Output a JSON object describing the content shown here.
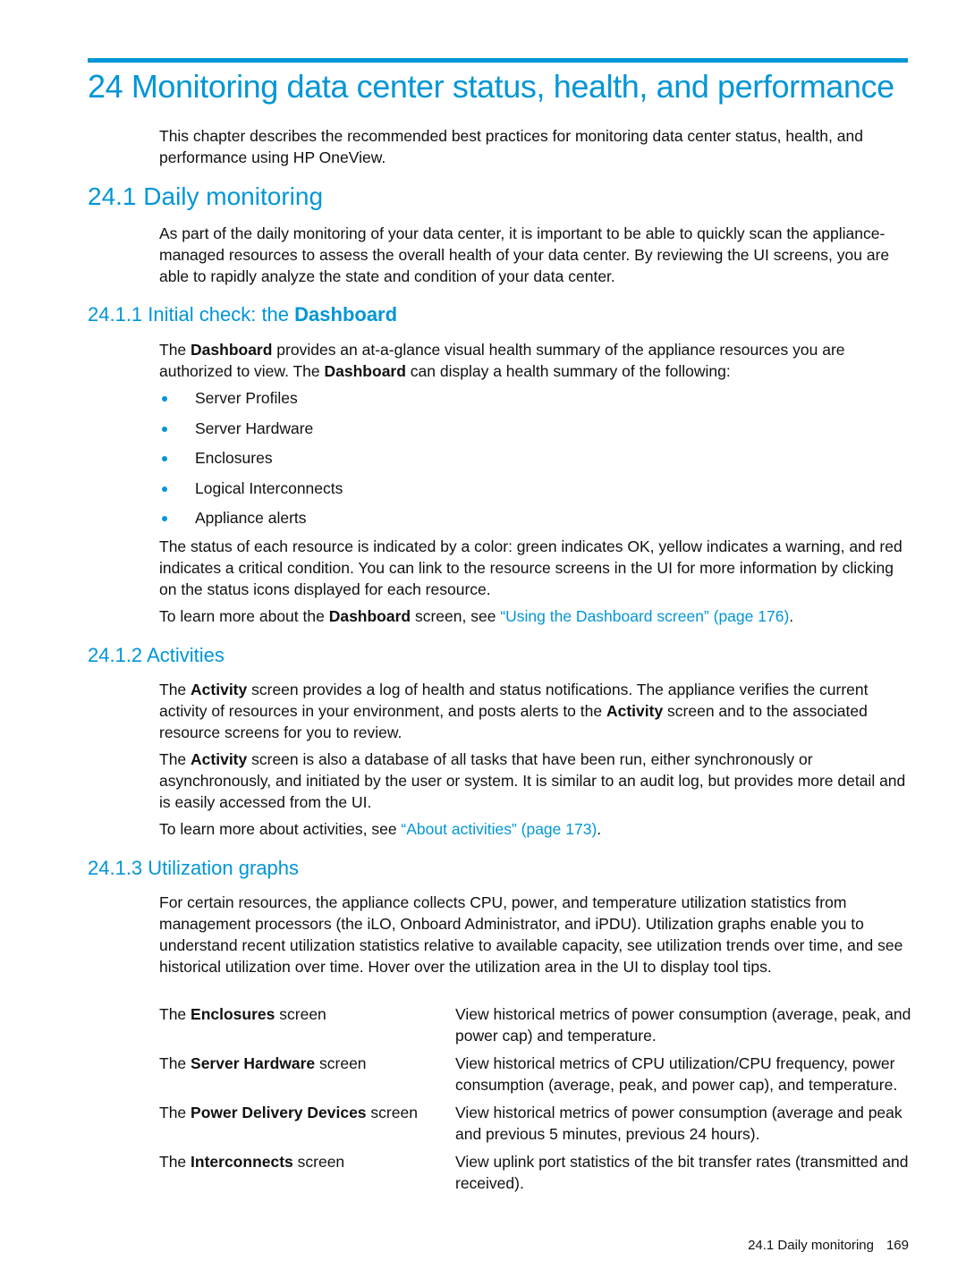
{
  "chapter": {
    "title": "24 Monitoring data center status, health, and performance",
    "intro": "This chapter describes the recommended best practices for monitoring data center status, health, and performance using HP OneView."
  },
  "section_24_1": {
    "heading": "24.1 Daily monitoring",
    "body": "As part of the daily monitoring of your data center, it is important to be able to quickly scan the appliance-managed resources to assess the overall health of your data center. By reviewing the UI screens, you are able to rapidly analyze the state and condition of your data center."
  },
  "section_24_1_1": {
    "heading_prefix": "24.1.1 Initial check: the ",
    "heading_bold": "Dashboard",
    "p1": {
      "t1": "The ",
      "b1": "Dashboard",
      "t2": " provides an at-a-glance visual health summary of the appliance resources you are authorized to view. The ",
      "b2": "Dashboard",
      "t3": " can display a health summary of the following:"
    },
    "bullets": [
      "Server Profiles",
      "Server Hardware",
      "Enclosures",
      "Logical Interconnects",
      "Appliance alerts"
    ],
    "p2": "The status of each resource is indicated by a color: green indicates OK, yellow indicates a warning, and red indicates a critical condition. You can link to the resource screens in the UI for more information by clicking on the status icons displayed for each resource.",
    "p3": {
      "t1": "To learn more about the ",
      "b1": "Dashboard",
      "t2": " screen, see ",
      "link": "“Using the Dashboard screen” (page 176)",
      "t3": "."
    }
  },
  "section_24_1_2": {
    "heading": "24.1.2 Activities",
    "p1": {
      "t1": "The ",
      "b1": "Activity",
      "t2": " screen provides a log of health and status notifications. The appliance verifies the current activity of resources in your environment, and posts alerts to the ",
      "b2": "Activity",
      "t3": " screen and to the associated resource screens for you to review."
    },
    "p2": {
      "t1": "The ",
      "b1": "Activity",
      "t2": " screen is also a database of all tasks that have been run, either synchronously or asynchronously, and initiated by the user or system. It is similar to an audit log, but provides more detail and is easily accessed from the UI."
    },
    "p3": {
      "t1": "To learn more about activities, see ",
      "link": "“About activities” (page 173)",
      "t2": "."
    }
  },
  "section_24_1_3": {
    "heading": "24.1.3 Utilization graphs",
    "body": "For certain resources, the appliance collects CPU, power, and temperature utilization statistics from management processors (the iLO, Onboard Administrator, and iPDU). Utilization graphs enable you to understand recent utilization statistics relative to available capacity, see utilization trends over time, and see historical utilization over time. Hover over the utilization area in the UI to display tool tips.",
    "rows": [
      {
        "pre": "The ",
        "bold": "Enclosures",
        "post": " screen",
        "desc": "View historical metrics of power consumption (average, peak, and power cap) and temperature."
      },
      {
        "pre": "The ",
        "bold": "Server Hardware",
        "post": " screen",
        "desc": "View historical metrics of CPU utilization/CPU frequency, power consumption (average, peak, and power cap), and temperature."
      },
      {
        "pre": "The ",
        "bold": "Power Delivery Devices",
        "post": " screen",
        "desc": "View historical metrics of power consumption (average and peak and previous 5 minutes, previous 24 hours)."
      },
      {
        "pre": "The ",
        "bold": "Interconnects",
        "post": " screen",
        "desc": "View uplink port statistics of the bit transfer rates (transmitted and received)."
      }
    ]
  },
  "footer": {
    "section": "24.1 Daily monitoring",
    "page": "169"
  }
}
